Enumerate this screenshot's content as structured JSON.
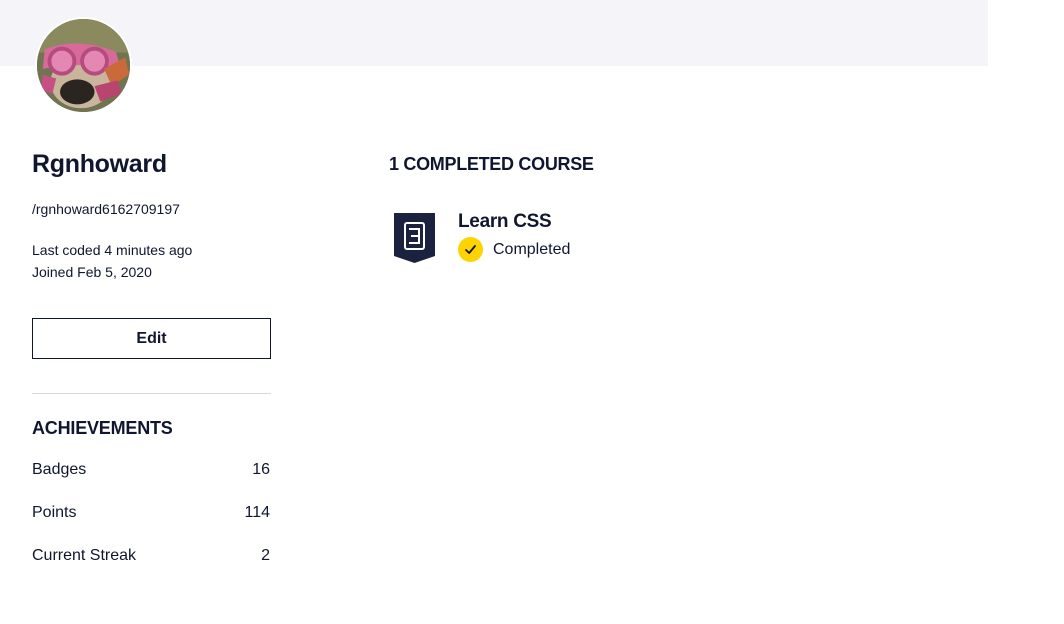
{
  "profile": {
    "name": "Rgnhoward",
    "handle": "/rgnhoward6162709197",
    "last_coded": "Last coded 4 minutes ago",
    "joined": "Joined Feb 5, 2020",
    "edit_label": "Edit"
  },
  "achievements": {
    "title": "ACHIEVEMENTS",
    "items": [
      {
        "label": "Badges",
        "value": "16"
      },
      {
        "label": "Points",
        "value": "114"
      },
      {
        "label": "Current Streak",
        "value": "2"
      }
    ]
  },
  "courses": {
    "title": "1 COMPLETED COURSE",
    "items": [
      {
        "name": "Learn CSS",
        "status": "Completed",
        "icon": "css-shield-icon",
        "icon_color": "#1a2240"
      }
    ]
  },
  "colors": {
    "banner": "#f5f4f8",
    "text": "#10162f",
    "completed_badge": "#ffd300"
  }
}
